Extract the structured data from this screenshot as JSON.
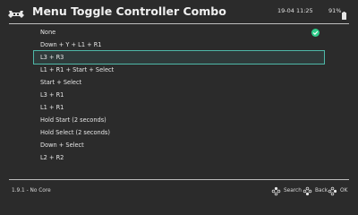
{
  "header": {
    "title": "Menu Toggle Controller Combo",
    "clock": "19-04 11:25",
    "battery": "91%"
  },
  "list": {
    "items": [
      {
        "label": "None",
        "checked": true
      },
      {
        "label": "Down + Y + L1 + R1"
      },
      {
        "label": "L3 + R3",
        "selected": true
      },
      {
        "label": "L1 + R1 + Start + Select"
      },
      {
        "label": "Start + Select"
      },
      {
        "label": "L3 + R1"
      },
      {
        "label": "L1 + R1"
      },
      {
        "label": "Hold Start (2 seconds)"
      },
      {
        "label": "Hold Select (2 seconds)"
      },
      {
        "label": "Down + Select"
      },
      {
        "label": "L2 + R2"
      }
    ]
  },
  "footer": {
    "core_status": "1.9.1 - No Core",
    "search_label": "Search",
    "back_label": "Back",
    "ok_label": "OK"
  },
  "colors": {
    "background": "#2b2b2b",
    "selection_border": "#4fb8a8",
    "check": "#2ecc8a"
  }
}
